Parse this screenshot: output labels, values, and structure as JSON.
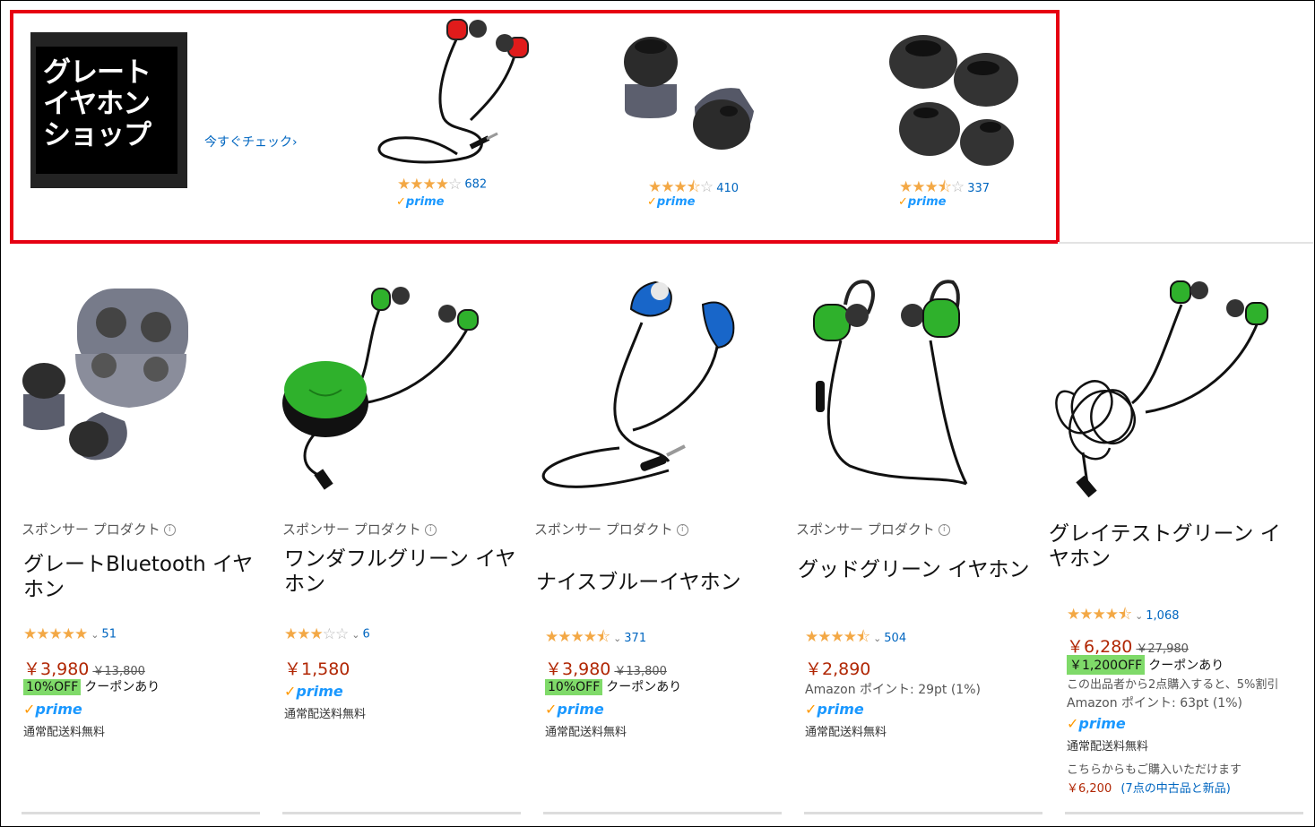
{
  "banner": {
    "logo_text_line1": "グレート",
    "logo_text_line2": "イヤホン",
    "logo_text_line3": "ショップ",
    "check_link": "今すぐチェック›",
    "items": [
      {
        "image": "red-earphones",
        "rating": 4,
        "reviews": "682",
        "prime": "prime"
      },
      {
        "image": "earbud-tips-gray",
        "rating": 3.5,
        "reviews": "410",
        "prime": "prime"
      },
      {
        "image": "earbud-tips-black",
        "rating": 3.5,
        "reviews": "337",
        "prime": "prime"
      }
    ]
  },
  "products": [
    {
      "image": "earbuds-case",
      "sponsored": "スポンサー プロダクト",
      "title": "グレートBluetooth イヤホン",
      "rating": 5,
      "reviews": "51",
      "price": "￥3,980",
      "list_price": "￥13,800",
      "coupon": "10%OFF",
      "coupon_text": "クーポンあり",
      "prime": "prime",
      "shipping": "通常配送料無料"
    },
    {
      "image": "green-earphones-reel",
      "sponsored": "スポンサー プロダクト",
      "title": "ワンダフルグリーン イヤホン",
      "rating": 3,
      "reviews": "6",
      "price": "￥1,580",
      "prime": "prime",
      "shipping": "通常配送料無料"
    },
    {
      "image": "blue-earphones",
      "sponsored": "スポンサー プロダクト",
      "title": "ナイスブルーイヤホン",
      "rating": 4.5,
      "reviews": "371",
      "price": "￥3,980",
      "list_price": "￥13,800",
      "coupon": "10%OFF",
      "coupon_text": "クーポンあり",
      "prime": "prime",
      "shipping": "通常配送料無料"
    },
    {
      "image": "green-sport-earphones",
      "sponsored": "スポンサー プロダクト",
      "title": "グッドグリーン イヤホン",
      "rating": 4.5,
      "reviews": "504",
      "price": "￥2,890",
      "points": "Amazon ポイント: 29pt (1%)",
      "prime": "prime",
      "shipping": "通常配送料無料"
    },
    {
      "image": "tangled-green-earphones",
      "title": "グレイテストグリーン イヤホン",
      "rating": 4.5,
      "reviews": "1,068",
      "price": "￥6,280",
      "list_price": "￥27,980",
      "coupon": "￥1,200OFF",
      "coupon_text": "クーポンあり",
      "multi_buy": "この出品者から2点購入すると、5%割引",
      "points": "Amazon ポイント: 63pt (1%)",
      "prime": "prime",
      "shipping": "通常配送料無料",
      "other_offers_label": "こちらからもご購入いただけます",
      "other_offers_price": "￥6,200",
      "other_offers_link": "(7点の中古品と新品)"
    }
  ]
}
